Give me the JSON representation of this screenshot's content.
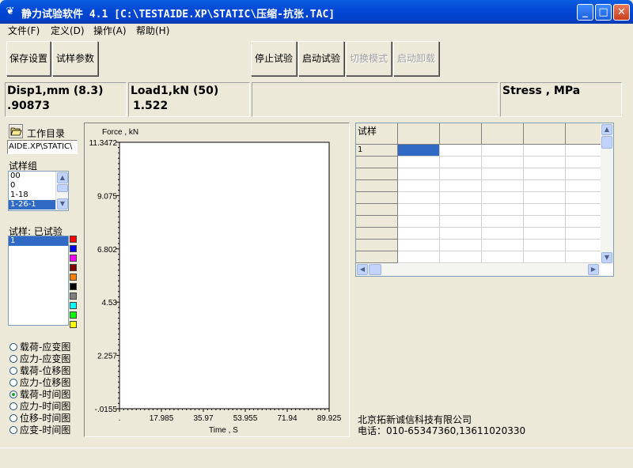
{
  "window": {
    "title": "静力试验软件 4.1 [C:\\TESTAIDE.XP\\STATIC\\压缩-抗张.TAC]",
    "icon": "app-icon"
  },
  "menu": [
    "文件(F)",
    "定义(D)",
    "操作(A)",
    "帮助(H)"
  ],
  "toolbar": {
    "save_settings": "保存设置",
    "sample_params": "试样参数",
    "stop_test": "停止试验",
    "start_test": "启动试验",
    "switch_mode": "切换模式",
    "start_unload": "启动卸载"
  },
  "readouts": {
    "disp_label": "Disp1,mm (8.3)",
    "disp_value": ".90873",
    "load_label": "Load1,kN (50)",
    "load_value": "1.522",
    "stress_label": "Stress , MPa",
    "stress_value": ""
  },
  "left_panel": {
    "workdir_label": "工作目录",
    "workdir_path": "AIDE.XP\\STATIC\\",
    "group_label": "试样组",
    "groups": [
      "00",
      "0",
      "1-18",
      "1-26-1"
    ],
    "selected_group": "1-26-1",
    "sample_label": "试样: 已试验",
    "samples": [
      "1"
    ],
    "swatch_colors": [
      "#FF0000",
      "#0000FF",
      "#FF00FF",
      "#800000",
      "#FF8000",
      "#000000",
      "#808080",
      "#00FFFF",
      "#00FF00",
      "#FFFF00"
    ],
    "plot_options": [
      "载荷-应变图",
      "应力-应变图",
      "载荷-位移图",
      "应力-位移图",
      "载荷-时间图",
      "应力-时间图",
      "位移-时间图",
      "应变-时间图"
    ],
    "selected_option": "载荷-时间图"
  },
  "chart_data": {
    "type": "line",
    "ylabel": "Force , kN",
    "xlabel": "Time , S",
    "y_ticks": [
      "11.3472",
      "9.075",
      "6.802",
      "4.53",
      "2.257",
      "-.0155"
    ],
    "x_ticks": [
      ".",
      "17.985",
      "35.97",
      "53.955",
      "71.94",
      "89.925"
    ],
    "ylim": [
      -0.0155,
      11.3472
    ],
    "xlim": [
      0,
      89.925
    ],
    "series": []
  },
  "grid": {
    "header": "试样",
    "rows": [
      "1",
      "",
      "",
      "",
      "",
      "",
      "",
      "",
      "",
      ""
    ]
  },
  "company": {
    "name": "北京拓新诚信科技有限公司",
    "phone": "电话：010-65347360,13611020330"
  }
}
